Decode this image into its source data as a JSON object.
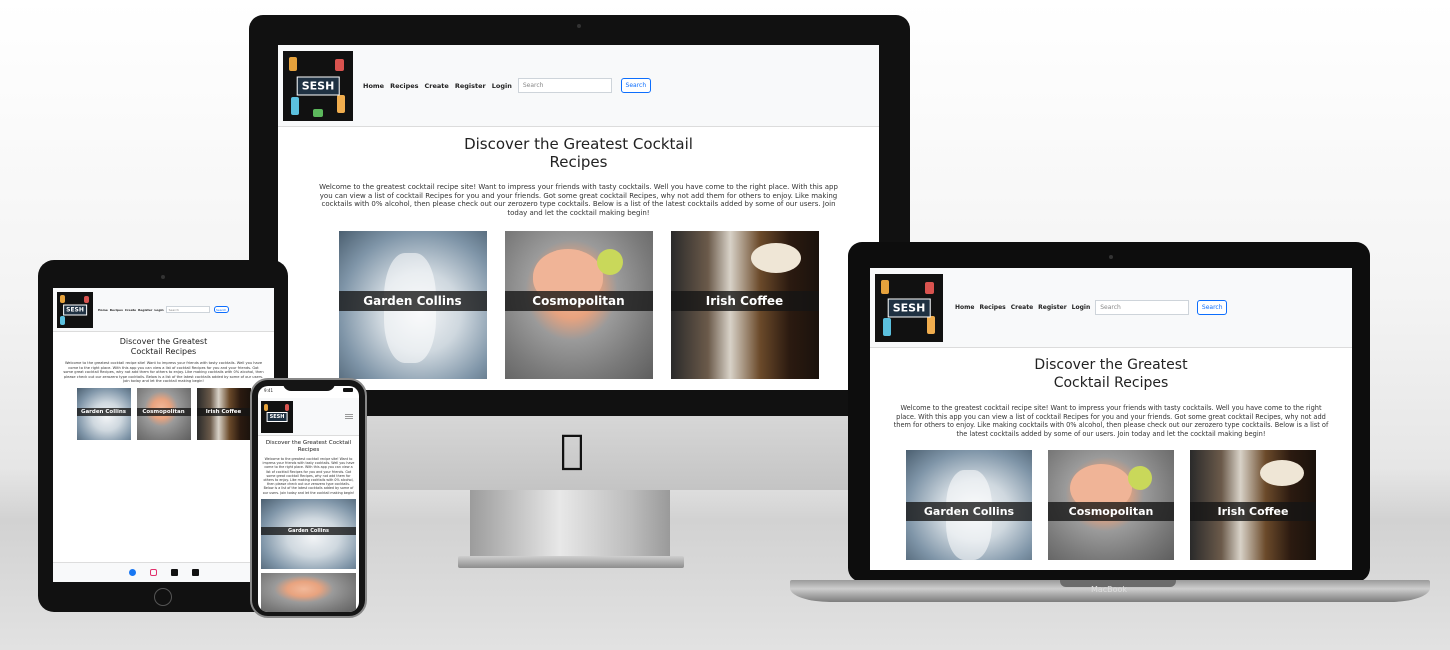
{
  "site": {
    "logo_text": "SESH",
    "nav": [
      "Home",
      "Recipes",
      "Create",
      "Register",
      "Login"
    ],
    "search_placeholder": "Search",
    "search_button": "Search",
    "title_line1": "Discover the Greatest Cocktail",
    "title_line2": "Recipes",
    "title_alt_line1": "Discover the Greatest",
    "title_alt_line2": "Cocktail Recipes",
    "phone_title": "Discover the Greatest Cocktail Recipes",
    "intro": "Welcome to the greatest cocktail recipe site! Want to impress your friends with tasty cocktails. Well you have come to the right place. With this app you can view a list of cocktail Recipes for you and your friends. Got some great cocktail Recipes, why not add them for others to enjoy. Like making cocktails with 0% alcohol, then please check out our zerozero type cocktails. Below is a list of the latest cocktails added by some of our users. Join today and let the cocktail making begin!",
    "cards": [
      {
        "name": "Garden Collins"
      },
      {
        "name": "Cosmopolitan"
      },
      {
        "name": "Irish Coffee"
      }
    ]
  },
  "devices": {
    "laptop_label": "MacBook",
    "phone_time": "9:41"
  },
  "footer_icons": [
    "facebook-icon",
    "instagram-icon",
    "tiktok-icon",
    "x-icon"
  ]
}
